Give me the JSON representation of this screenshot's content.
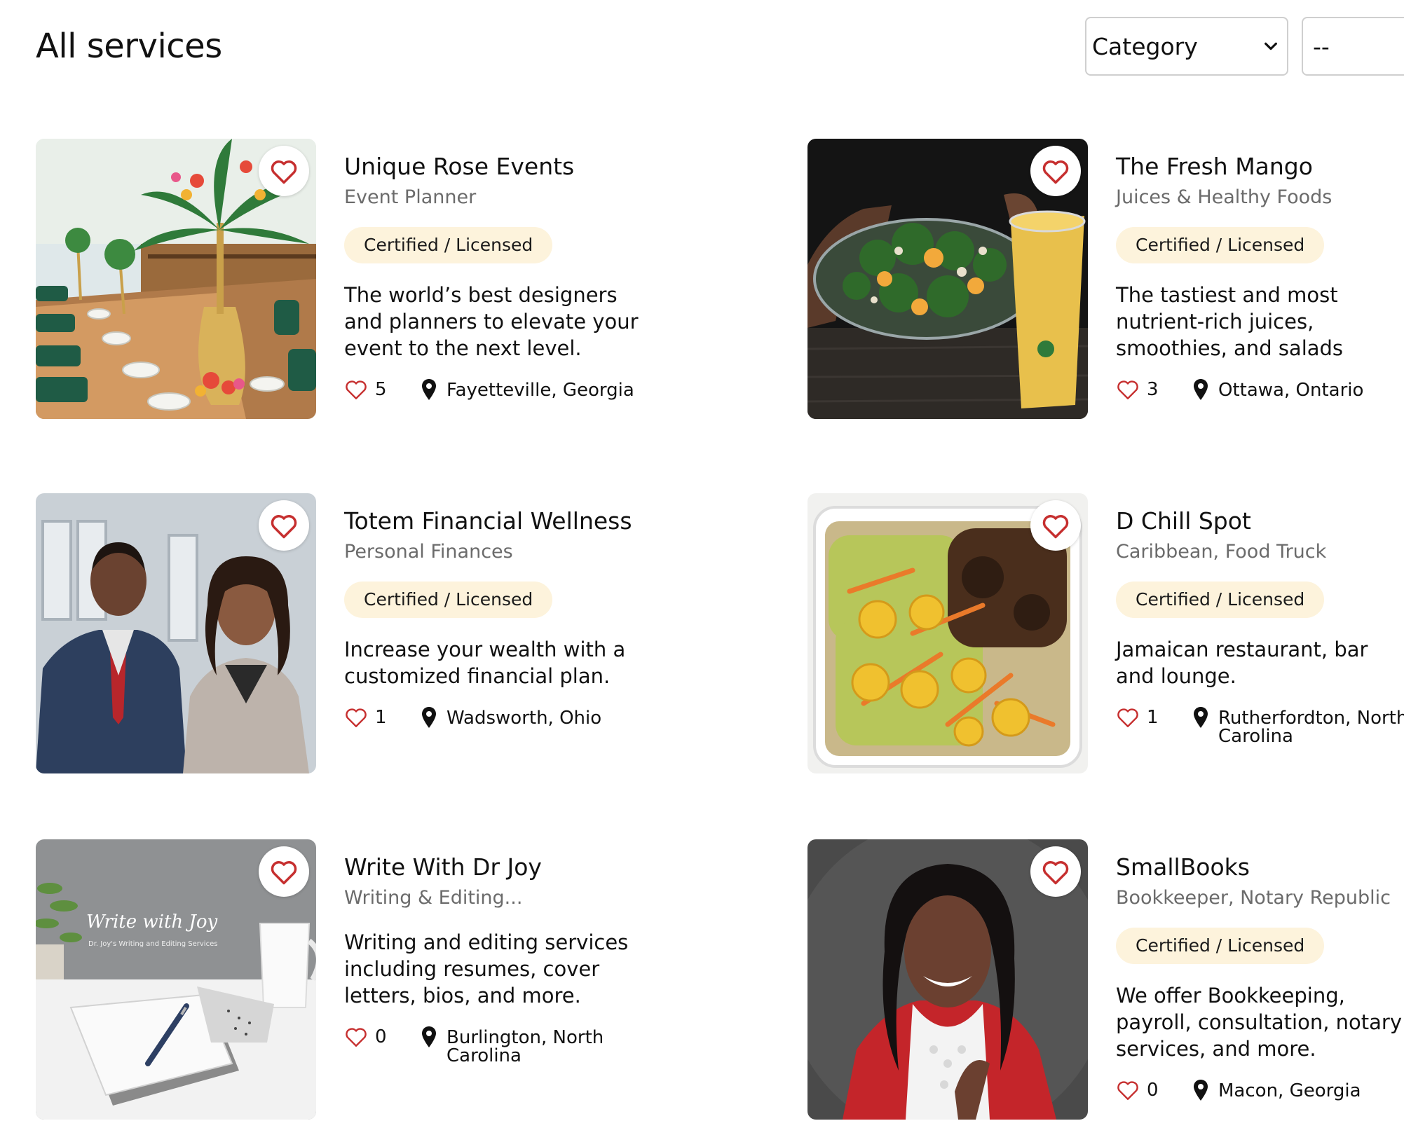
{
  "page": {
    "title": "All services"
  },
  "filters": {
    "category": "Category",
    "subcategory": "--"
  },
  "colors": {
    "heart": "#c62f2f",
    "badge_bg": "#fdf3dc",
    "muted": "#6b6b6b"
  },
  "services": [
    {
      "name": "Unique Rose Events",
      "category": "Event Planner",
      "badge": "Certified / Licensed",
      "description": "The world’s best designers and planners to elevate your event to the next level.",
      "likes": "5",
      "location": "Fayetteville, Georgia"
    },
    {
      "name": "The Fresh Mango",
      "category": "Juices & Healthy Foods",
      "badge": "Certified / Licensed",
      "description": "The tastiest and most nutrient-rich juices, smoothies, and salads",
      "likes": "3",
      "location": "Ottawa, Ontario"
    },
    {
      "name": "Totem Financial Wellness",
      "category": "Personal Finances",
      "badge": "Certified / Licensed",
      "description": "Increase your wealth with a customized financial plan.",
      "likes": "1",
      "location": "Wadsworth, Ohio"
    },
    {
      "name": "D Chill Spot",
      "category": "Caribbean, Food Truck",
      "badge": "Certified / Licensed",
      "description": "Jamaican restaurant, bar and lounge.",
      "likes": "1",
      "location": "Rutherfordton, North Carolina"
    },
    {
      "name": "Write With Dr Joy",
      "category": "Writing & Editing...",
      "description": "Writing and editing services including resumes, cover letters, bios, and more.",
      "likes": "0",
      "location": "Burlington, North Carolina",
      "image_text": {
        "title": "Write with Joy",
        "subtitle": "Dr. Joy's Writing and Editing Services"
      }
    },
    {
      "name": "SmallBooks",
      "category": "Bookkeeper, Notary Republic",
      "badge": "Certified / Licensed",
      "description": "We offer Bookkeeping, payroll, consultation, notary services, and more.",
      "likes": "0",
      "location": "Macon, Georgia"
    }
  ]
}
